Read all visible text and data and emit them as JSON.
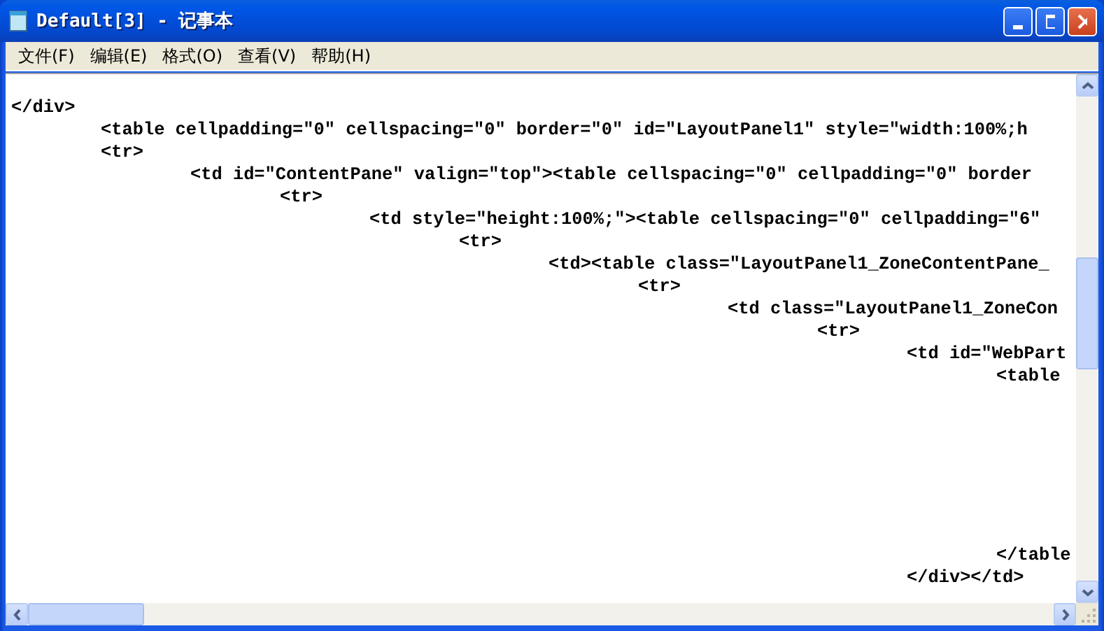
{
  "window": {
    "title": "Default[3] - 记事本"
  },
  "menu": [
    {
      "label": "文件(F)"
    },
    {
      "label": "编辑(E)"
    },
    {
      "label": "格式(O)"
    },
    {
      "label": "查看(V)"
    },
    {
      "label": "帮助(H)"
    }
  ],
  "document": {
    "text": "</div>\n\t<table cellpadding=\"0\" cellspacing=\"0\" border=\"0\" id=\"LayoutPanel1\" style=\"width:100%;h\n\t<tr>\n\t\t<td id=\"ContentPane\" valign=\"top\"><table cellspacing=\"0\" cellpadding=\"0\" border\n\t\t\t<tr>\n\t\t\t\t<td style=\"height:100%;\"><table cellspacing=\"0\" cellpadding=\"6\"\n\t\t\t\t\t<tr>\n\t\t\t\t\t\t<td><table class=\"LayoutPanel1_ZoneContentPane_\n\t\t\t\t\t\t\t<tr>\n\t\t\t\t\t\t\t\t<td class=\"LayoutPanel1_ZoneCon\n\t\t\t\t\t\t\t\t\t<tr>\n\t\t\t\t\t\t\t\t\t\t<td id=\"WebPart\n\t\t\t\t\t\t\t\t\t\t\t<table\n\n\n\n\n\n\n\n\t\t\t\t\t\t\t\t\t\t\t</table\n\t\t\t\t\t\t\t\t\t\t</div></td>"
  }
}
